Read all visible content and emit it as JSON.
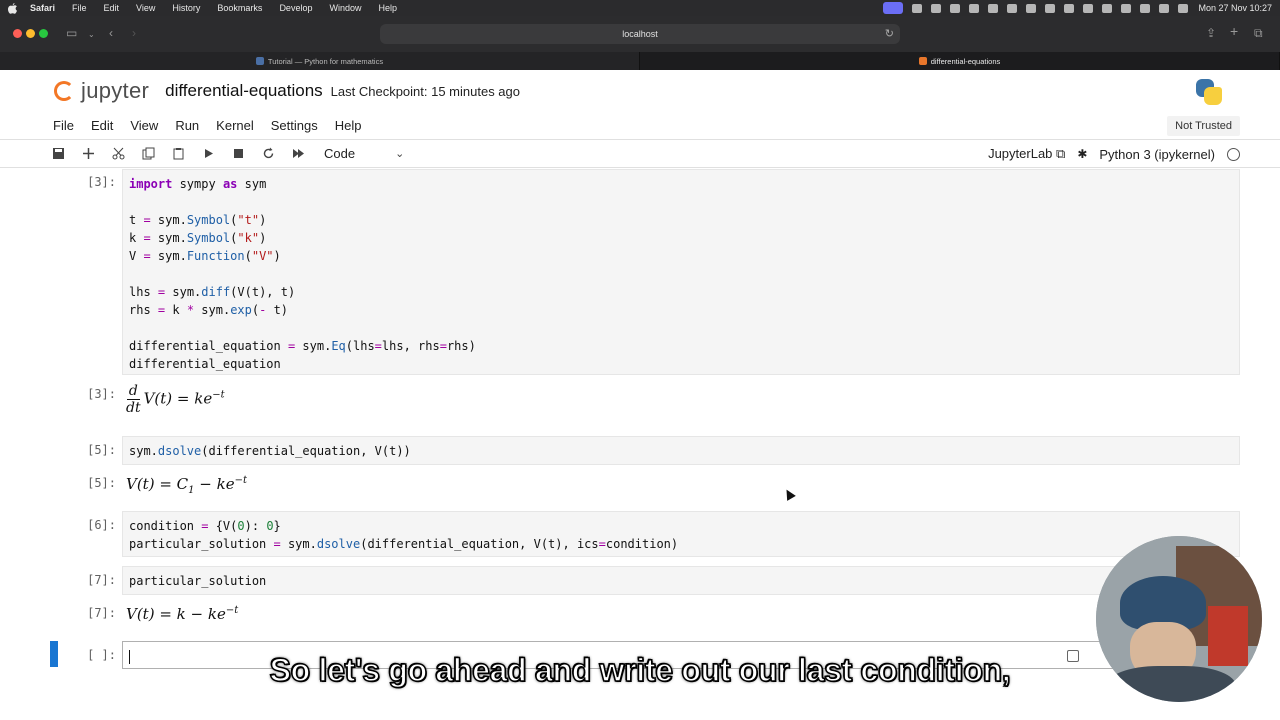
{
  "macos": {
    "menu": [
      "Safari",
      "File",
      "Edit",
      "View",
      "History",
      "Bookmarks",
      "Develop",
      "Window",
      "Help"
    ],
    "clock": "Mon 27 Nov  10:27"
  },
  "safari": {
    "url": "localhost",
    "tabs": [
      {
        "title": "Tutorial — Python for mathematics"
      },
      {
        "title": "differential-equations"
      }
    ]
  },
  "jupyter": {
    "brand": "jupyter",
    "notebook_name": "differential-equations",
    "checkpoint": "Last Checkpoint: 15 minutes ago",
    "menu": [
      "File",
      "Edit",
      "View",
      "Run",
      "Kernel",
      "Settings",
      "Help"
    ],
    "trusted": "Not Trusted",
    "cell_type": "Code",
    "jupyterlab_link": "JupyterLab",
    "kernel": "Python 3 (ipykernel)"
  },
  "cells": {
    "c3_prompt": "[3]:",
    "c3_out_prompt": "[3]:",
    "c5_prompt": "[5]:",
    "c5_out_prompt": "[5]:",
    "c6_prompt": "[6]:",
    "c7_prompt": "[7]:",
    "c7_out_prompt": "[7]:",
    "empty_prompt": "[ ]:",
    "c5_code": "sym.dsolve(differential_equation, V(t))",
    "c7_code": "particular_solution"
  },
  "subtitle": "So let's go ahead and write out our last condition,"
}
